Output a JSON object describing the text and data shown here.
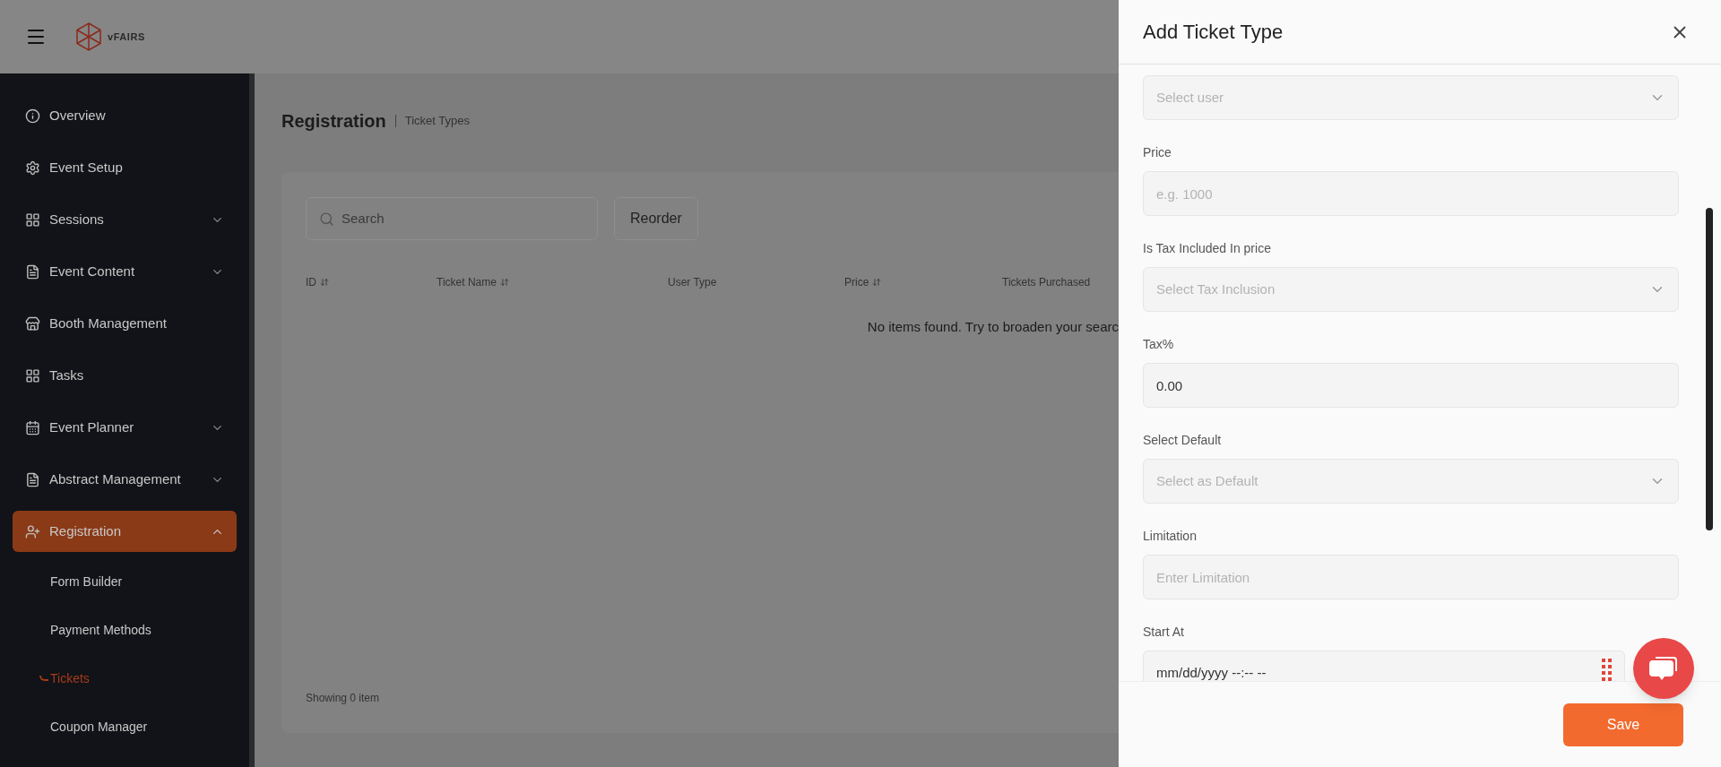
{
  "header": {
    "logo_text": "vFAIRS"
  },
  "sidebar": {
    "items": [
      {
        "label": "Overview",
        "expandable": false,
        "expanded": false,
        "selected": false
      },
      {
        "label": "Event Setup",
        "expandable": false,
        "expanded": false,
        "selected": false
      },
      {
        "label": "Sessions",
        "expandable": true,
        "expanded": false,
        "selected": false
      },
      {
        "label": "Event Content",
        "expandable": true,
        "expanded": false,
        "selected": false
      },
      {
        "label": "Booth Management",
        "expandable": false,
        "expanded": false,
        "selected": false
      },
      {
        "label": "Tasks",
        "expandable": false,
        "expanded": false,
        "selected": false
      },
      {
        "label": "Event Planner",
        "expandable": true,
        "expanded": false,
        "selected": false
      },
      {
        "label": "Abstract Management",
        "expandable": true,
        "expanded": false,
        "selected": false
      },
      {
        "label": "Registration",
        "expandable": true,
        "expanded": true,
        "selected": true,
        "children": [
          {
            "label": "Form Builder",
            "selected": false
          },
          {
            "label": "Payment Methods",
            "selected": false
          },
          {
            "label": "Tickets",
            "selected": true
          },
          {
            "label": "Coupon Manager",
            "selected": false
          }
        ]
      }
    ]
  },
  "page": {
    "title": "Registration",
    "subtitle": "Ticket Types"
  },
  "toolbar": {
    "search": {
      "placeholder": "Search"
    },
    "reorder_button": "Reorder"
  },
  "table": {
    "columns": [
      {
        "label": "ID",
        "sortable": true
      },
      {
        "label": "Ticket Name",
        "sortable": true
      },
      {
        "label": "User Type",
        "sortable": false
      },
      {
        "label": "Price",
        "sortable": true
      },
      {
        "label": "Tickets Purchased",
        "sortable": false
      }
    ],
    "empty_message": "No items found. Try to broaden your searc",
    "footer": "Showing 0 item"
  },
  "drawer": {
    "title": "Add Ticket Type",
    "fields": [
      {
        "kind": "select",
        "placeholder": "Select user"
      },
      {
        "kind": "input",
        "label": "Price",
        "placeholder": "e.g. 1000"
      },
      {
        "kind": "select",
        "label": "Is Tax Included In price",
        "placeholder": "Select Tax Inclusion"
      },
      {
        "kind": "input",
        "label": "Tax%",
        "value": "0.00"
      },
      {
        "kind": "select",
        "label": "Select Default",
        "placeholder": "Select as Default"
      },
      {
        "kind": "input",
        "label": "Limitation",
        "placeholder": "Enter Limitation"
      },
      {
        "kind": "date",
        "label": "Start At",
        "value": "mm/dd/yyyy --:-- --"
      }
    ],
    "save_button": "Save"
  }
}
